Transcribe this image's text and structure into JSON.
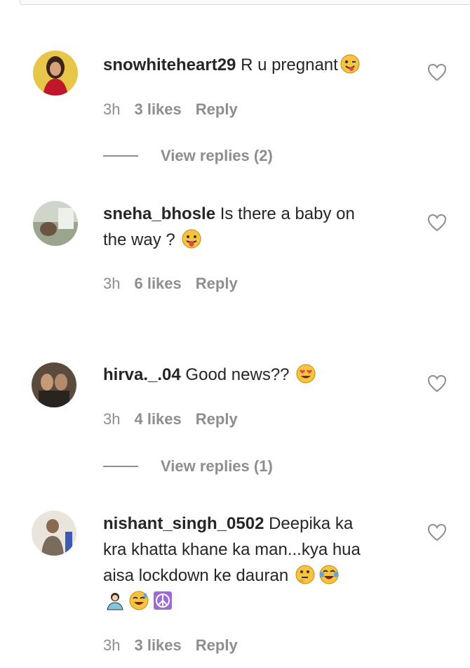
{
  "comments": [
    {
      "username": "snowhiteheart29",
      "text": "R u pregnant",
      "time": "3h",
      "likes": "3 likes",
      "reply": "Reply",
      "view_replies": "View replies (2)"
    },
    {
      "username": "sneha_bhosle",
      "text_line1": "Is there a baby on",
      "text_line2": "the way ?",
      "time": "3h",
      "likes": "6 likes",
      "reply": "Reply"
    },
    {
      "username": "hirva._.04",
      "text": "Good news??",
      "time": "3h",
      "likes": "4 likes",
      "reply": "Reply",
      "view_replies": "View replies (1)"
    },
    {
      "username": "nishant_singh_0502",
      "text_line1": "Deepika ka",
      "text_line2": "kra khatta khane ka man...kya hua",
      "text_line3": "aisa lockdown ke dauran",
      "time": "3h",
      "likes": "3 likes",
      "reply": "Reply"
    }
  ],
  "icons": {
    "like": "heart-outline-icon",
    "emoji_tongue_wink": "winking-tongue-emoji",
    "emoji_tongue": "tongue-out-emoji",
    "emoji_heart_eyes": "heart-eyes-emoji",
    "emoji_thinking": "thinking-emoji",
    "emoji_tears_joy": "tears-of-joy-emoji",
    "emoji_person": "person-emoji",
    "emoji_sweat_smile": "sweat-smile-emoji",
    "emoji_peace": "peace-symbol-emoji"
  },
  "colors": {
    "text": "#262626",
    "meta": "#8e8e8e",
    "emoji_yellow": "#f7c341"
  }
}
